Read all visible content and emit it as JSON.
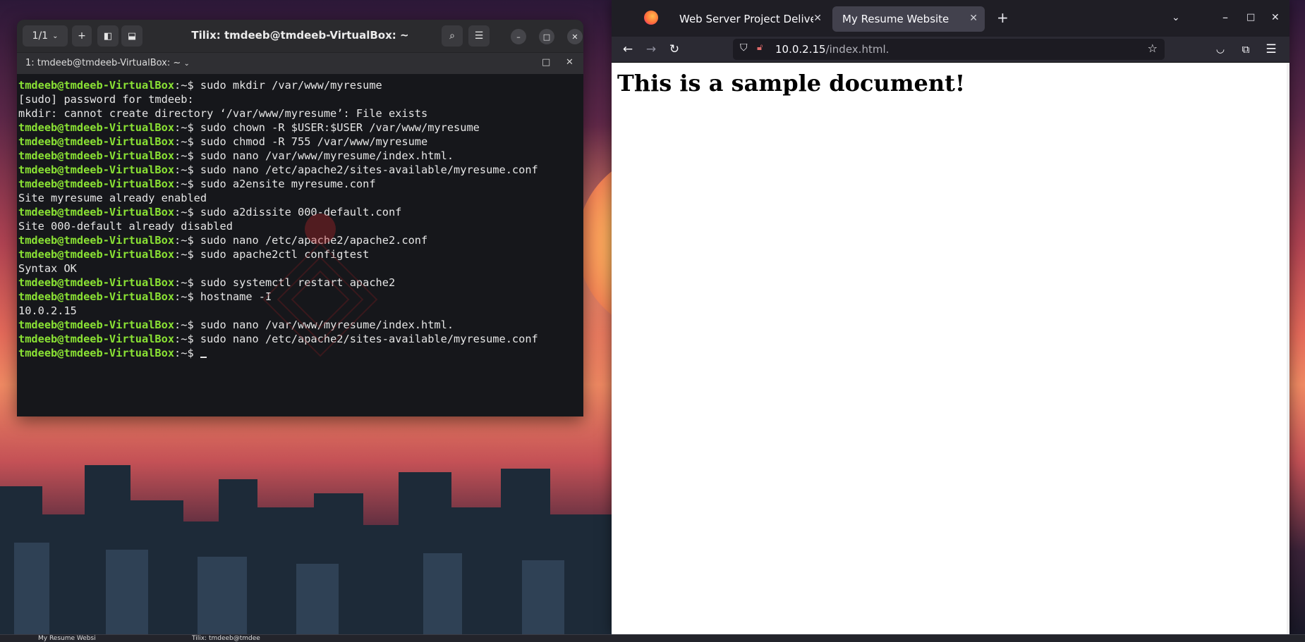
{
  "terminal": {
    "session_counter": "1/1",
    "title": "Tilix: tmdeeb@tmdeeb-VirtualBox: ~",
    "subtitle": "1: tmdeeb@tmdeeb-VirtualBox: ~",
    "lines": [
      {
        "prompt": "tmdeeb@tmdeeb-VirtualBox",
        "path": ":~$ ",
        "cmd": "sudo mkdir /var/www/myresume"
      },
      {
        "out": "[sudo] password for tmdeeb:"
      },
      {
        "out": "mkdir: cannot create directory ‘/var/www/myresume’: File exists"
      },
      {
        "prompt": "tmdeeb@tmdeeb-VirtualBox",
        "path": ":~$ ",
        "cmd": "sudo chown -R $USER:$USER /var/www/myresume"
      },
      {
        "prompt": "tmdeeb@tmdeeb-VirtualBox",
        "path": ":~$ ",
        "cmd": "sudo chmod -R 755 /var/www/myresume"
      },
      {
        "prompt": "tmdeeb@tmdeeb-VirtualBox",
        "path": ":~$ ",
        "cmd": "sudo nano /var/www/myresume/index.html."
      },
      {
        "prompt": "tmdeeb@tmdeeb-VirtualBox",
        "path": ":~$ ",
        "cmd": "sudo nano /etc/apache2/sites-available/myresume.conf"
      },
      {
        "prompt": "tmdeeb@tmdeeb-VirtualBox",
        "path": ":~$ ",
        "cmd": "sudo a2ensite myresume.conf"
      },
      {
        "out": "Site myresume already enabled"
      },
      {
        "prompt": "tmdeeb@tmdeeb-VirtualBox",
        "path": ":~$ ",
        "cmd": "sudo a2dissite 000-default.conf"
      },
      {
        "out": "Site 000-default already disabled"
      },
      {
        "prompt": "tmdeeb@tmdeeb-VirtualBox",
        "path": ":~$ ",
        "cmd": "sudo nano /etc/apache2/apache2.conf"
      },
      {
        "prompt": "tmdeeb@tmdeeb-VirtualBox",
        "path": ":~$ ",
        "cmd": "sudo apache2ctl configtest"
      },
      {
        "out": "Syntax OK"
      },
      {
        "prompt": "tmdeeb@tmdeeb-VirtualBox",
        "path": ":~$ ",
        "cmd": "sudo systemctl restart apache2"
      },
      {
        "prompt": "tmdeeb@tmdeeb-VirtualBox",
        "path": ":~$ ",
        "cmd": "hostname -I"
      },
      {
        "out": "10.0.2.15"
      },
      {
        "prompt": "tmdeeb@tmdeeb-VirtualBox",
        "path": ":~$ ",
        "cmd": "sudo nano /var/www/myresume/index.html."
      },
      {
        "prompt": "tmdeeb@tmdeeb-VirtualBox",
        "path": ":~$ ",
        "cmd": "sudo nano /etc/apache2/sites-available/myresume.conf"
      },
      {
        "prompt": "tmdeeb@tmdeeb-VirtualBox",
        "path": ":~$ ",
        "cmd": "",
        "cursor": true
      }
    ]
  },
  "browser": {
    "tabs": [
      {
        "title": "Web Server Project Deliverab",
        "active": false
      },
      {
        "title": "My Resume Website",
        "active": true
      }
    ],
    "url_host": "10.0.2.15",
    "url_path": "/index.html.",
    "page_heading": "This is a sample document!"
  },
  "taskbar": {
    "items": [
      "My Resume Websi",
      "Tilix: tmdeeb@tmdee"
    ]
  },
  "colors": {
    "prompt": "#8ae234",
    "terminal_bg": "#16171b",
    "browser_chrome": "#2b2a33",
    "browser_tabbar": "#1f1e25"
  }
}
